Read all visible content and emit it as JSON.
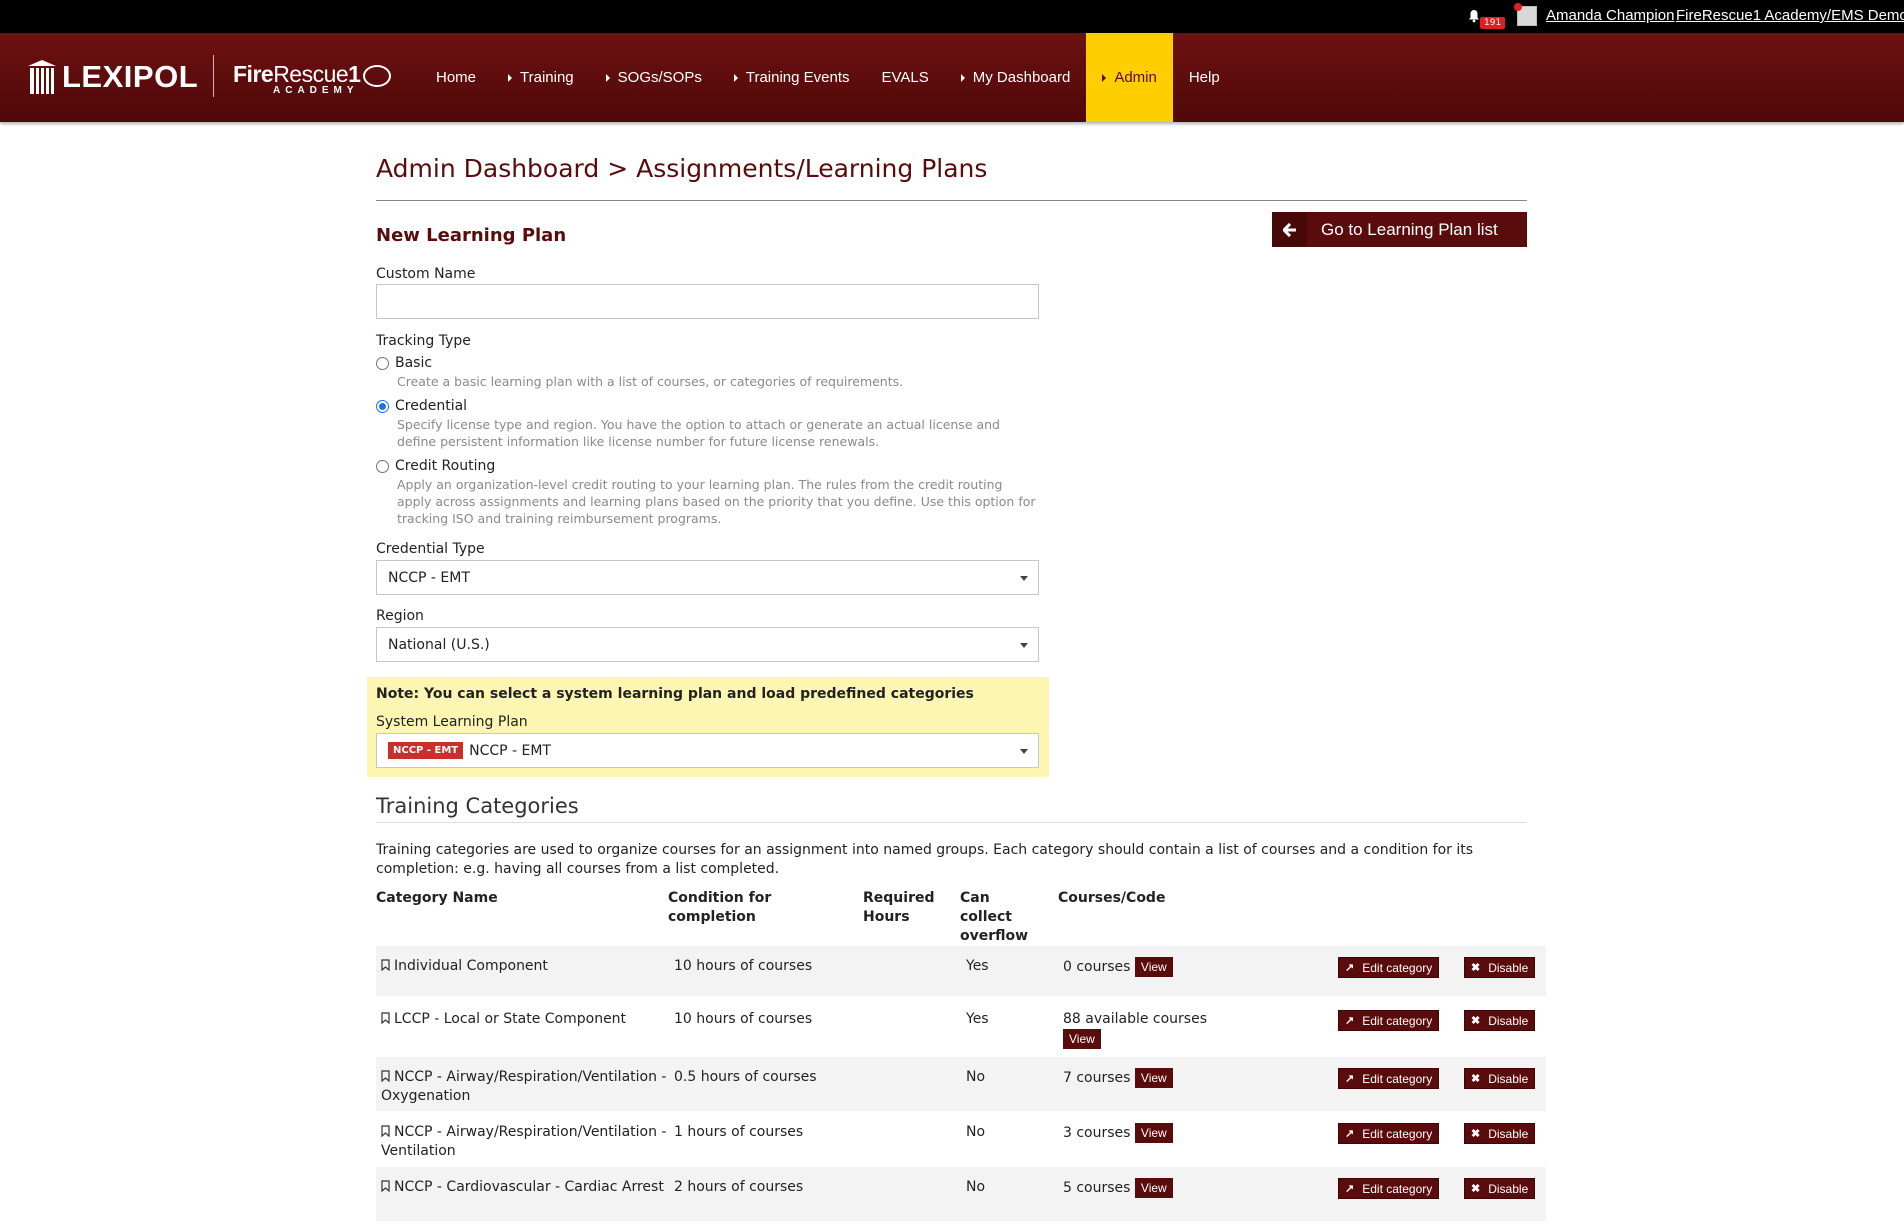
{
  "topbar": {
    "notification_count": "191",
    "user_name": "Amanda Champion",
    "org_name": "FireRescue1 Academy/EMS Demo"
  },
  "brand": {
    "lexipol": "LEXIPOL",
    "fr_bold": "Fire",
    "fr_thin": "Rescue",
    "fr_num": "1",
    "fr_sub": "ACADEMY"
  },
  "nav": {
    "items": [
      {
        "label": "Home",
        "caret": false,
        "active": false
      },
      {
        "label": "Training",
        "caret": true,
        "active": false
      },
      {
        "label": "SOGs/SOPs",
        "caret": true,
        "active": false
      },
      {
        "label": "Training Events",
        "caret": true,
        "active": false
      },
      {
        "label": "EVALS",
        "caret": false,
        "active": false
      },
      {
        "label": "My Dashboard",
        "caret": true,
        "active": false
      },
      {
        "label": "Admin",
        "caret": true,
        "active": true
      },
      {
        "label": "Help",
        "caret": false,
        "active": false
      }
    ]
  },
  "page": {
    "title": "Admin Dashboard > Assignments/Learning Plans",
    "section_title": "New Learning Plan",
    "goto_label": "Go to Learning Plan list"
  },
  "form": {
    "custom_name_label": "Custom Name",
    "custom_name_value": "",
    "tracking_type_label": "Tracking Type",
    "tracking_options": [
      {
        "label": "Basic",
        "help": "Create a basic learning plan with a list of courses, or categories of requirements.",
        "checked": false
      },
      {
        "label": "Credential",
        "help": "Specify license type and region. You have the option to attach or generate an actual license and define persistent information like license number for future license renewals.",
        "checked": true
      },
      {
        "label": "Credit Routing",
        "help": "Apply an organization-level credit routing to your learning plan. The rules from the credit routing apply across assignments and learning plans based on the priority that you define. Use this option for tracking ISO and training reimbursement programs.",
        "checked": false
      }
    ],
    "credential_type_label": "Credential Type",
    "credential_type_value": "NCCP - EMT",
    "region_label": "Region",
    "region_value": "National (U.S.)",
    "note": "Note: You can select a system learning plan and load predefined categories",
    "system_plan_label": "System Learning Plan",
    "system_plan_tag": "NCCP - EMT",
    "system_plan_value": "NCCP - EMT"
  },
  "categories": {
    "title": "Training Categories",
    "description": "Training categories are used to organize courses for an assignment into named groups. Each category should contain a list of courses and a condition for its completion: e.g. having all courses from a list completed.",
    "headers": {
      "name": "Category Name",
      "condition": "Condition for completion",
      "hours": "Required Hours",
      "overflow": "Can collect overflow",
      "courses": "Courses/Code"
    },
    "edit_label": "Edit category",
    "disable_label": "Disable",
    "view_label": "View",
    "rows": [
      {
        "name": "Individual Component",
        "condition": "10 hours of courses",
        "hours": "",
        "overflow": "Yes",
        "courses": "0 courses"
      },
      {
        "name": "LCCP - Local or State Component",
        "condition": "10 hours of courses",
        "hours": "",
        "overflow": "Yes",
        "courses": "88 available courses"
      },
      {
        "name": "NCCP - Airway/Respiration/Ventilation - Oxygenation",
        "condition": "0.5 hours of courses",
        "hours": "",
        "overflow": "No",
        "courses": "7 courses"
      },
      {
        "name": "NCCP - Airway/Respiration/Ventilation - Ventilation",
        "condition": "1 hours of courses",
        "hours": "",
        "overflow": "No",
        "courses": "3 courses"
      },
      {
        "name": "NCCP - Cardiovascular - Cardiac Arrest",
        "condition": "2 hours of courses",
        "hours": "",
        "overflow": "No",
        "courses": "5 courses"
      }
    ]
  },
  "colors": {
    "brand": "#5a0b0b",
    "nav_active": "#ffce00",
    "note_bg": "#fdf6b2",
    "tag": "#c9302c"
  }
}
